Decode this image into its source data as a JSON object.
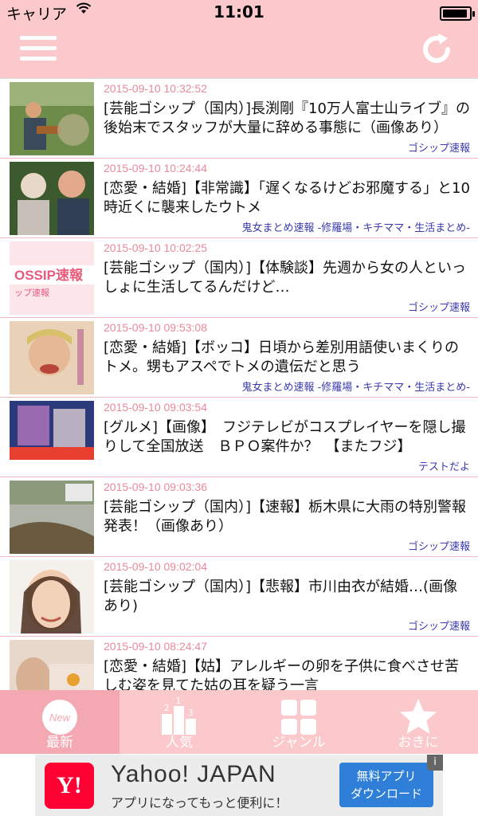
{
  "status": {
    "carrier": "キャリア",
    "time": "11:01",
    "battery": 0.95
  },
  "colors": {
    "header": "#fbc8cc",
    "tab_active": "#f4a9b2",
    "date": "#e88a9a",
    "source": "#3a3ab0"
  },
  "articles": [
    {
      "date": "2015-09-10 10:32:52",
      "title": "[芸能ゴシップ（国内）]長渕剛『10万人富士山ライブ』の後始末でスタッフが大量に辞める事態に（画像あり）",
      "source": "ゴシップ速報"
    },
    {
      "date": "2015-09-10 10:24:44",
      "title": "[恋愛・結婚]【非常識】「遅くなるけどお邪魔する」と10時近くに襲来したウトメ",
      "source": "鬼女まとめ速報 -修羅場・キチママ・生活まとめ-"
    },
    {
      "date": "2015-09-10 10:02:25",
      "title": "[芸能ゴシップ（国内）]【体験談】先週から女の人といっしょに生活してるんだけど…",
      "source": "ゴシップ速報"
    },
    {
      "date": "2015-09-10 09:53:08",
      "title": "[恋愛・結婚]【ボッコ】日頃から差別用語使いまくりのトメ。甥もアスペでトメの遺伝だと思う",
      "source": "鬼女まとめ速報 -修羅場・キチママ・生活まとめ-"
    },
    {
      "date": "2015-09-10 09:03:54",
      "title": "[グルメ]【画像】　フジテレビがコスプレイヤーを隠し撮りして全国放送　ＢＰＯ案件か？　【またフジ】",
      "source": "テストだよ"
    },
    {
      "date": "2015-09-10 09:03:36",
      "title": "[芸能ゴシップ（国内）]【速報】栃木県に大雨の特別警報発表！（画像あり）",
      "source": "ゴシップ速報"
    },
    {
      "date": "2015-09-10 09:02:04",
      "title": "[芸能ゴシップ（国内）]【悲報】市川由衣が結婚…(画像あり)",
      "source": "ゴシップ速報"
    },
    {
      "date": "2015-09-10 08:24:47",
      "title": "[恋愛・結婚]【姑】アレルギーの卵を子供に食べさせ苦しむ姿を見てた姑の耳を疑う一言",
      "source": ""
    }
  ],
  "thumb_texts": {
    "gossip": "OSSIP速報",
    "gossip_sub": "ップ速報"
  },
  "tabs": [
    {
      "label": "最新",
      "badge": "New",
      "icon": "new-icon"
    },
    {
      "label": "人気",
      "icon": "ranking-icon"
    },
    {
      "label": "ジャンル",
      "icon": "grid-icon"
    },
    {
      "label": "おきに",
      "icon": "star-icon"
    }
  ],
  "ad": {
    "logo": "Y!",
    "name": "Yahoo! JAPAN",
    "sub": "アプリになってもっと便利に！",
    "cta_line1": "無料アプリ",
    "cta_line2": "ダウンロード",
    "info": "i"
  }
}
